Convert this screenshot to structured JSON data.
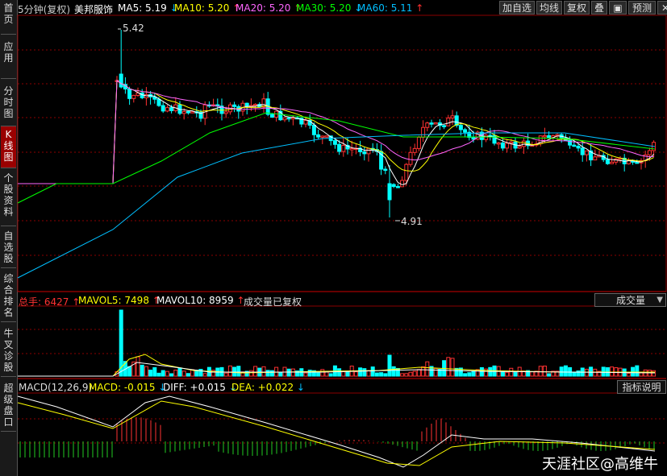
{
  "sidebar": {
    "tabs": [
      {
        "label": "首页",
        "active": false
      },
      {
        "label": "应用",
        "active": false
      },
      {
        "label": "分时图",
        "active": false
      },
      {
        "label": "K线图",
        "active": true
      },
      {
        "label": "个股资料",
        "active": false
      },
      {
        "label": "自选股",
        "active": false
      },
      {
        "label": "综合排名",
        "active": false
      },
      {
        "label": "牛叉诊股",
        "active": false
      },
      {
        "label": "超级盘口",
        "active": false
      }
    ]
  },
  "header": {
    "period": "5分钟(复权)",
    "stock_name": "美邦服饰",
    "ma5": {
      "label": "MA5: 5.19",
      "arrow": "↓",
      "color": "#ffffff",
      "arrow_color": "#00bfff"
    },
    "ma10": {
      "label": "MA10: 5.20",
      "arrow": "↑",
      "color": "#ffff00",
      "arrow_color": "#ff3030"
    },
    "ma20": {
      "label": "MA20: 5.20",
      "arrow": "↑",
      "color": "#ff66ff",
      "arrow_color": "#ff3030"
    },
    "ma30": {
      "label": "MA30: 5.20",
      "arrow": "↓",
      "color": "#00ff00",
      "arrow_color": "#00bfff"
    },
    "ma60": {
      "label": "MA60: 5.11",
      "arrow": "↑",
      "color": "#00bfff",
      "arrow_color": "#ff3030"
    },
    "toolbar": [
      "加自选",
      "均线",
      "复权",
      "叠",
      "预测"
    ]
  },
  "price_annotations": {
    "high": "5.42",
    "low": "4.91"
  },
  "volume_panel": {
    "total_label": "总手: 6427",
    "total_arrow": "↑",
    "mavol5": "MAVOL5: 7498",
    "mavol5_arrow": "↑",
    "mavol10": "MAVOL10: 8959",
    "mavol10_arrow": "↑",
    "note": "成交量已复权",
    "dropdown": "成交量"
  },
  "macd_panel": {
    "title": "MACD(12,26,9)",
    "macd": "MACD: -0.015",
    "macd_arrow": "↓",
    "diff": "DIFF: +0.015",
    "diff_arrow": "↓",
    "dea": "DEA: +0.022",
    "dea_arrow": "↓",
    "button": "指标说明"
  },
  "watermark": "天涯社区@高维牛",
  "colors": {
    "up": "#ff3232",
    "down": "#00ffff",
    "grid": "#8b0000",
    "axis": "#8b0000"
  }
}
